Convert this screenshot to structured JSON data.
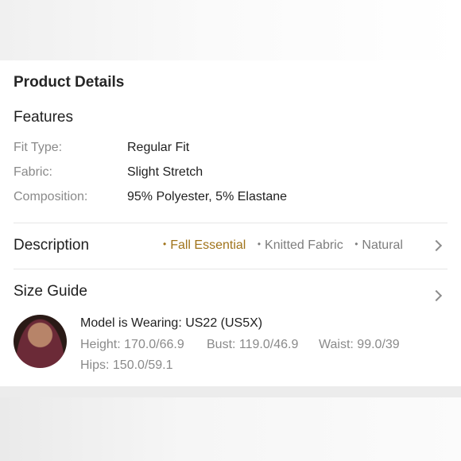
{
  "product_details": {
    "title": "Product Details",
    "features": {
      "title": "Features",
      "rows": [
        {
          "label": "Fit Type:",
          "value": "Regular Fit"
        },
        {
          "label": "Fabric:",
          "value": "Slight Stretch"
        },
        {
          "label": "Composition:",
          "value": "95% Polyester, 5% Elastane"
        }
      ]
    },
    "description": {
      "title": "Description",
      "tags": [
        "Fall Essential",
        "Knitted Fabric",
        "Natural"
      ],
      "active_tag_color": "#a0731a"
    },
    "size_guide": {
      "title": "Size Guide",
      "model_wearing": "Model is Wearing: US22 (US5X)",
      "height": "Height: 170.0/66.9",
      "bust": "Bust: 119.0/46.9",
      "waist": "Waist: 99.0/39",
      "hips": "Hips: 150.0/59.1"
    },
    "icons": [
      "chevron-right-icon",
      "model-avatar"
    ]
  }
}
